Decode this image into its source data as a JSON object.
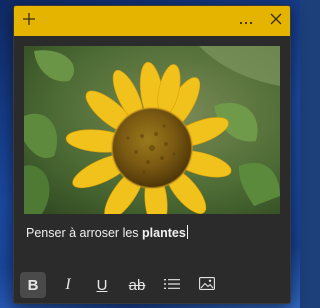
{
  "note": {
    "titlebar": {
      "add_icon": "plus-icon",
      "more_icon": "ellipsis-icon",
      "close_icon": "close-icon",
      "color": "#e5b400"
    },
    "image": {
      "subject": "sunflower-photo"
    },
    "content": {
      "text_regular": "Penser à arroser les ",
      "text_bold": "plantes"
    },
    "toolbar": {
      "bold_label": "B",
      "italic_label": "I",
      "underline_label": "U",
      "strikethrough_label": "ab",
      "bold_active": true,
      "list_icon": "bullet-list-icon",
      "image_icon": "image-icon"
    }
  },
  "theme": {
    "note_background": "#2b2b2b",
    "accent": "#e5b400",
    "text": "#f0f0f0"
  }
}
